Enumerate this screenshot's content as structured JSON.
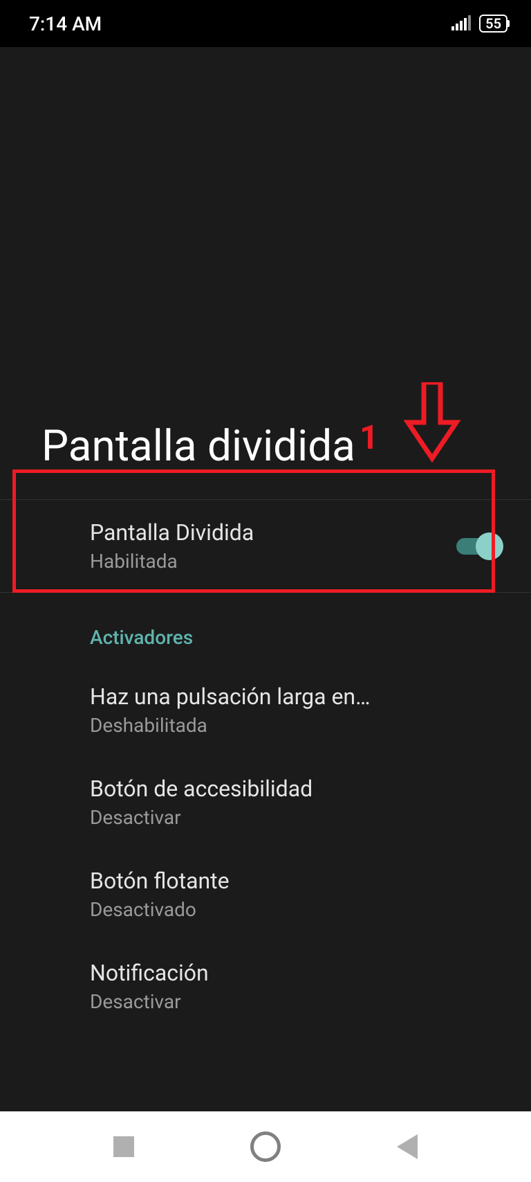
{
  "status_bar": {
    "time": "7:14 AM",
    "battery": "55"
  },
  "header": {
    "title": "Pantalla dividida"
  },
  "annotation": {
    "number": "1"
  },
  "settings": {
    "main_toggle": {
      "title": "Pantalla Dividida",
      "subtitle": "Habilitada",
      "enabled": true
    },
    "section_label": "Activadores",
    "items": [
      {
        "title": "Haz una pulsación larga en…",
        "subtitle": "Deshabilitada"
      },
      {
        "title": "Botón de accesibilidad",
        "subtitle": "Desactivar"
      },
      {
        "title": "Botón flotante",
        "subtitle": "Desactivado"
      },
      {
        "title": "Notificación",
        "subtitle": "Desactivar"
      }
    ]
  }
}
